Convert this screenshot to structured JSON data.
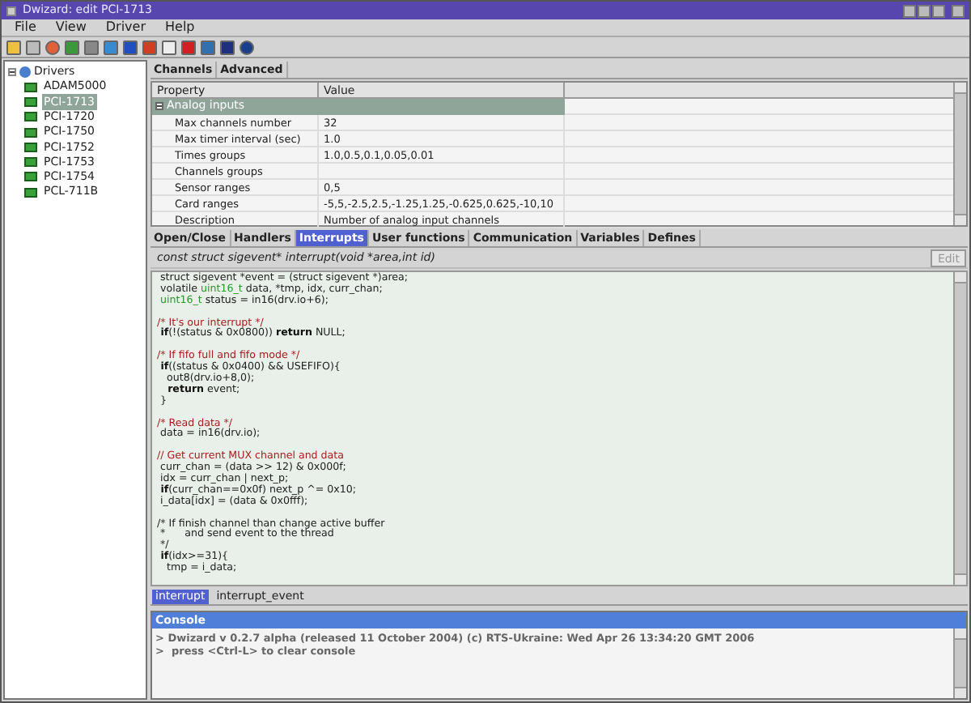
{
  "window": {
    "title": "Dwizard: edit PCI-1713"
  },
  "menu": [
    "File",
    "View",
    "Driver",
    "Help"
  ],
  "tree": {
    "label": "Drivers",
    "expanded": true,
    "children": [
      {
        "label": "ADAM5000",
        "selected": false
      },
      {
        "label": "PCI-1713",
        "selected": true
      },
      {
        "label": "PCI-1720",
        "selected": false
      },
      {
        "label": "PCI-1750",
        "selected": false
      },
      {
        "label": "PCI-1752",
        "selected": false
      },
      {
        "label": "PCI-1753",
        "selected": false
      },
      {
        "label": "PCI-1754",
        "selected": false
      },
      {
        "label": "PCL-711B",
        "selected": false
      }
    ]
  },
  "top_tabs": [
    {
      "label": "Channels",
      "selected": false
    },
    {
      "label": "Advanced",
      "selected": false
    }
  ],
  "properties": {
    "columns": [
      "Property",
      "Value"
    ],
    "group": {
      "label": "Analog inputs",
      "expanded": true,
      "selected": true
    },
    "rows": [
      {
        "property": "Max channels number",
        "value": "32"
      },
      {
        "property": "Max timer interval (sec)",
        "value": "1.0"
      },
      {
        "property": "Times groups",
        "value": "1.0,0.5,0.1,0.05,0.01"
      },
      {
        "property": "Channels groups"
      },
      {
        "property": "Sensor ranges",
        "value": "0,5"
      },
      {
        "property": "Card ranges",
        "value": "-5,5,-2.5,2.5,-1.25,1.25,-0.625,0.625,-10,10"
      },
      {
        "property": "Description",
        "value": "Number of analog input channels"
      }
    ]
  },
  "code_tabs": [
    {
      "label": "Open/Close",
      "selected": false
    },
    {
      "label": "Handlers",
      "selected": false
    },
    {
      "label": "Interrupts",
      "selected": true
    },
    {
      "label": "User functions",
      "selected": false
    },
    {
      "label": "Communication",
      "selected": false
    },
    {
      "label": "Variables",
      "selected": false
    },
    {
      "label": "Defines",
      "selected": false
    }
  ],
  "signature": "const struct sigevent* interrupt(void *area,int id)",
  "edit_button": {
    "label": "Edit",
    "disabled": true
  },
  "code": [
    {
      "kind": "code",
      "parts": [
        {
          "kind": "plain",
          "text": " struct sigevent *event = (struct sigevent *)area;"
        }
      ]
    },
    {
      "kind": "code",
      "parts": [
        {
          "kind": "plain",
          "text": " volatile "
        },
        {
          "kind": "type",
          "text": "uint16_t"
        },
        {
          "kind": "plain",
          "text": " data, *tmp, idx, curr_chan;"
        }
      ]
    },
    {
      "kind": "code",
      "parts": [
        {
          "kind": "type",
          "text": " uint16_t"
        },
        {
          "kind": "plain",
          "text": " status = in16(drv.io+6);"
        }
      ]
    },
    {
      "kind": "blank"
    },
    {
      "kind": "code",
      "parts": [
        {
          "kind": "comment",
          "text": "/* It's our interrupt */"
        }
      ]
    },
    {
      "kind": "code",
      "parts": [
        {
          "kind": "keyword",
          "text": " if"
        },
        {
          "kind": "plain",
          "text": "(!(status & 0x0800)) "
        },
        {
          "kind": "keyword",
          "text": "return"
        },
        {
          "kind": "plain",
          "text": " NULL;"
        }
      ]
    },
    {
      "kind": "blank"
    },
    {
      "kind": "code",
      "parts": [
        {
          "kind": "comment",
          "text": "/* If fifo full and fifo mode */"
        }
      ]
    },
    {
      "kind": "code",
      "parts": [
        {
          "kind": "keyword",
          "text": " if"
        },
        {
          "kind": "plain",
          "text": "((status & 0x0400) && USEFIFO){"
        }
      ]
    },
    {
      "kind": "code",
      "parts": [
        {
          "kind": "plain",
          "text": "   out8(drv.io+8,0);"
        }
      ]
    },
    {
      "kind": "code",
      "parts": [
        {
          "kind": "keyword",
          "text": "   return"
        },
        {
          "kind": "plain",
          "text": " event;"
        }
      ]
    },
    {
      "kind": "code",
      "parts": [
        {
          "kind": "plain",
          "text": " }"
        }
      ]
    },
    {
      "kind": "blank"
    },
    {
      "kind": "code",
      "parts": [
        {
          "kind": "comment",
          "text": "/* Read data */"
        }
      ]
    },
    {
      "kind": "code",
      "parts": [
        {
          "kind": "plain",
          "text": " data = in16(drv.io);"
        }
      ]
    },
    {
      "kind": "blank"
    },
    {
      "kind": "code",
      "parts": [
        {
          "kind": "comment",
          "text": "// Get current MUX channel and data"
        }
      ]
    },
    {
      "kind": "code",
      "parts": [
        {
          "kind": "plain",
          "text": " curr_chan = (data >> 12) & 0x000f;"
        }
      ]
    },
    {
      "kind": "code",
      "parts": [
        {
          "kind": "plain",
          "text": " idx = curr_chan | next_p;"
        }
      ]
    },
    {
      "kind": "code",
      "parts": [
        {
          "kind": "keyword",
          "text": " if"
        },
        {
          "kind": "plain",
          "text": "(curr_chan==0x0f) next_p ^= 0x10;"
        }
      ]
    },
    {
      "kind": "code",
      "parts": [
        {
          "kind": "plain",
          "text": " i_data[idx] = (data & 0x0fff);"
        }
      ]
    },
    {
      "kind": "blank"
    },
    {
      "kind": "code",
      "parts": [
        {
          "kind": "plain",
          "text": "/* If finish channel than change active buffer"
        }
      ]
    },
    {
      "kind": "code",
      "parts": [
        {
          "kind": "plain",
          "text": " *      and send event to the thread"
        }
      ]
    },
    {
      "kind": "code",
      "parts": [
        {
          "kind": "plain",
          "text": " */"
        }
      ]
    },
    {
      "kind": "code",
      "parts": [
        {
          "kind": "keyword",
          "text": " if"
        },
        {
          "kind": "plain",
          "text": "(idx>=31){"
        }
      ]
    },
    {
      "kind": "code",
      "parts": [
        {
          "kind": "plain",
          "text": "   tmp = i_data;"
        }
      ]
    }
  ],
  "bottom_tabs": [
    {
      "label": "interrupt",
      "selected": true
    },
    {
      "label": "interrupt_event",
      "selected": false
    }
  ],
  "console": {
    "title": "Console",
    "lines": [
      "> Dwizard v 0.2.7 alpha (released 11 October 2004) (c) RTS-Ukraine: Wed Apr 26 13:34:20 GMT 2006",
      ">  press <Ctrl-L> to clear console"
    ]
  }
}
